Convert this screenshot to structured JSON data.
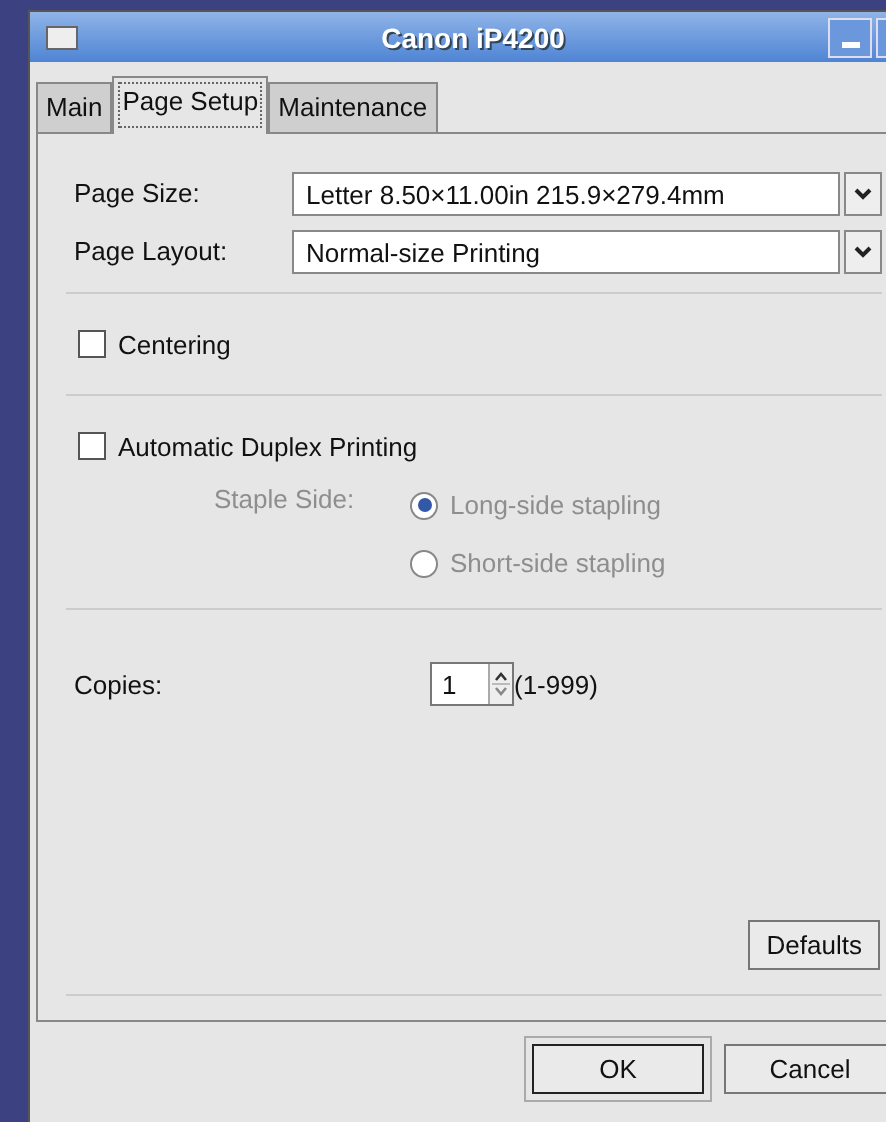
{
  "window": {
    "title": "Canon iP4200"
  },
  "tabs": [
    {
      "label": "Main",
      "selected": false
    },
    {
      "label": "Page Setup",
      "selected": true
    },
    {
      "label": "Maintenance",
      "selected": false
    }
  ],
  "page_size": {
    "label": "Page Size:",
    "value": "Letter 8.50×11.00in 215.9×279.4mm"
  },
  "page_layout": {
    "label": "Page Layout:",
    "value": "Normal-size Printing"
  },
  "centering": {
    "label": "Centering",
    "checked": false
  },
  "duplex": {
    "label": "Automatic Duplex Printing",
    "checked": false
  },
  "staple_side": {
    "label": "Staple Side:",
    "disabled": true,
    "options": [
      {
        "label": "Long-side stapling",
        "selected": true
      },
      {
        "label": "Short-side stapling",
        "selected": false
      }
    ]
  },
  "copies": {
    "label": "Copies:",
    "value": "1",
    "range": "(1-999)"
  },
  "defaults_button": "Defaults",
  "buttons": [
    {
      "label": "OK",
      "default": true
    },
    {
      "label": "Cancel",
      "default": false
    }
  ]
}
